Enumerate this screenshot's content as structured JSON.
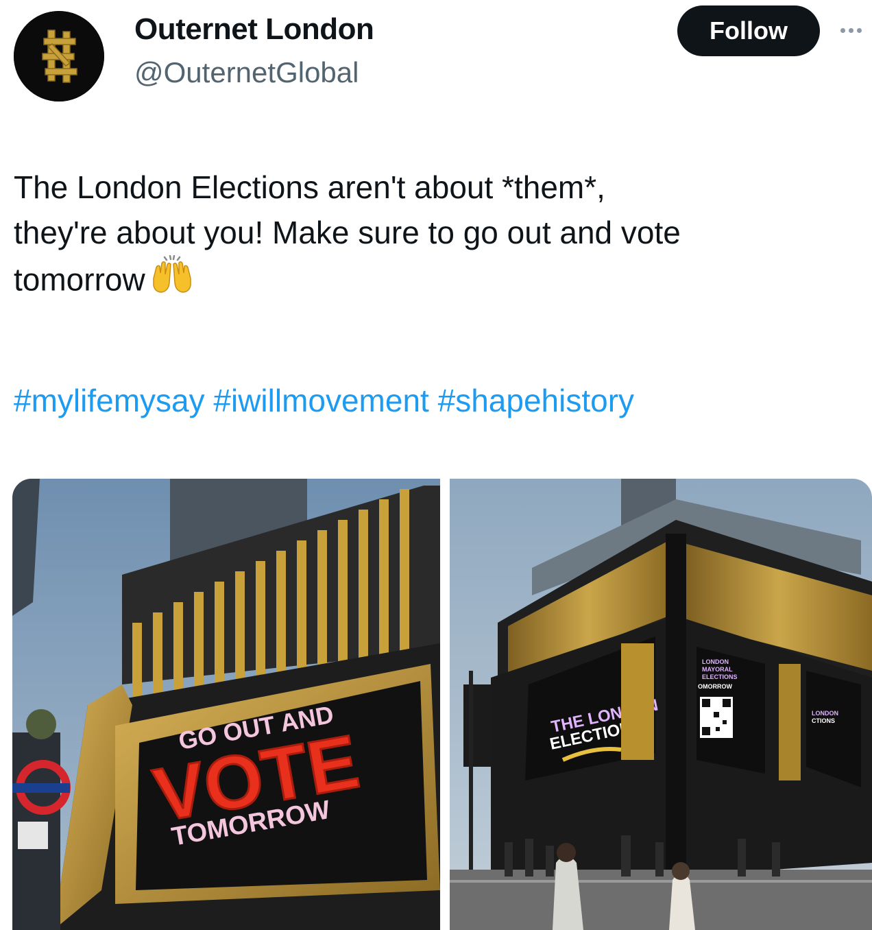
{
  "account": {
    "name": "Outernet London",
    "handle": "@OuternetGlobal",
    "follow_label": "Follow"
  },
  "tweet": {
    "lines": [
      "The London Elections aren't about *them*,",
      "they're about you! Make sure to go out and vote",
      "tomorrow"
    ],
    "emoji": "raising-hands",
    "hashtags": [
      "#mylifemysay",
      "#iwillmovement",
      "#shapehistory"
    ]
  },
  "photos": {
    "left": {
      "screen_text": [
        "GO OUT AND",
        "VOTE",
        "TOMORROW"
      ]
    },
    "right": {
      "screen_text_main": [
        "THE LONDON",
        "ELECTIONS"
      ],
      "screen_text_side": [
        "LONDON",
        "MAYORAL",
        "ELECTIONS",
        "OMORROW"
      ],
      "screen_text_far": [
        "LONDON",
        "CTIONS"
      ]
    }
  },
  "colors": {
    "follow_bg": "#0f1419",
    "hashtag": "#1d9bf0",
    "handle": "#536471",
    "vote_red": "#e8301c",
    "gold": "#b8902e"
  },
  "icons": [
    "outernet-logo-icon",
    "more-options-icon",
    "raising-hands-icon"
  ]
}
